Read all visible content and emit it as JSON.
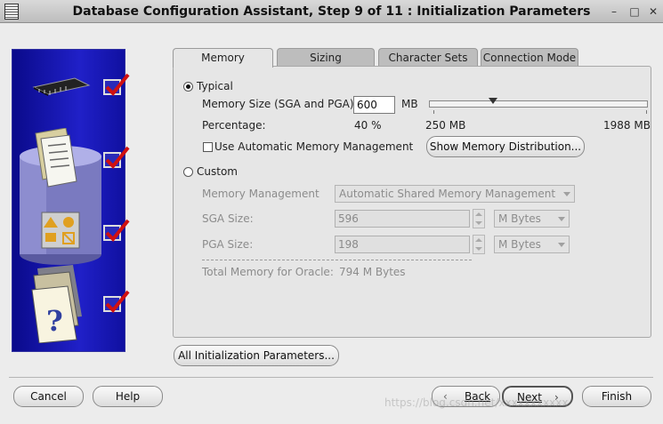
{
  "window": {
    "title": "Database Configuration Assistant, Step 9 of 11 : Initialization Parameters"
  },
  "tabs": [
    {
      "label": "Memory",
      "active": true
    },
    {
      "label": "Sizing",
      "active": false
    },
    {
      "label": "Character Sets",
      "active": false
    },
    {
      "label": "Connection Mode",
      "active": false
    }
  ],
  "memory": {
    "typical_label": "Typical",
    "typical_selected": true,
    "memory_size_label": "Memory Size (SGA and PGA):",
    "memory_size_value": "600",
    "memory_size_unit": "MB",
    "slider_fraction": 0.2,
    "slider_min_label": "250 MB",
    "slider_max_label": "1988 MB",
    "percentage_label": "Percentage:",
    "percentage_value": "40 %",
    "amm_label": "Use Automatic Memory Management",
    "amm_checked": false,
    "show_distribution_button": "Show Memory Distribution...",
    "custom_label": "Custom",
    "custom_selected": false,
    "memory_management_label": "Memory Management",
    "memory_management_value": "Automatic Shared Memory Management",
    "sga_label": "SGA Size:",
    "sga_value": "596",
    "sga_unit": "M Bytes",
    "pga_label": "PGA Size:",
    "pga_value": "198",
    "pga_unit": "M Bytes",
    "total_label": "Total Memory for Oracle:",
    "total_value": "794 M Bytes"
  },
  "all_params_button": "All Initialization Parameters...",
  "footer": {
    "cancel": "Cancel",
    "help": "Help",
    "back": "Back",
    "next": "Next",
    "finish": "Finish"
  },
  "watermark": "https://blog.csdn.net/xxxxxxxxxxx",
  "colors": {
    "side_panel": "#1a1ab0",
    "check_mark": "#d01010"
  }
}
